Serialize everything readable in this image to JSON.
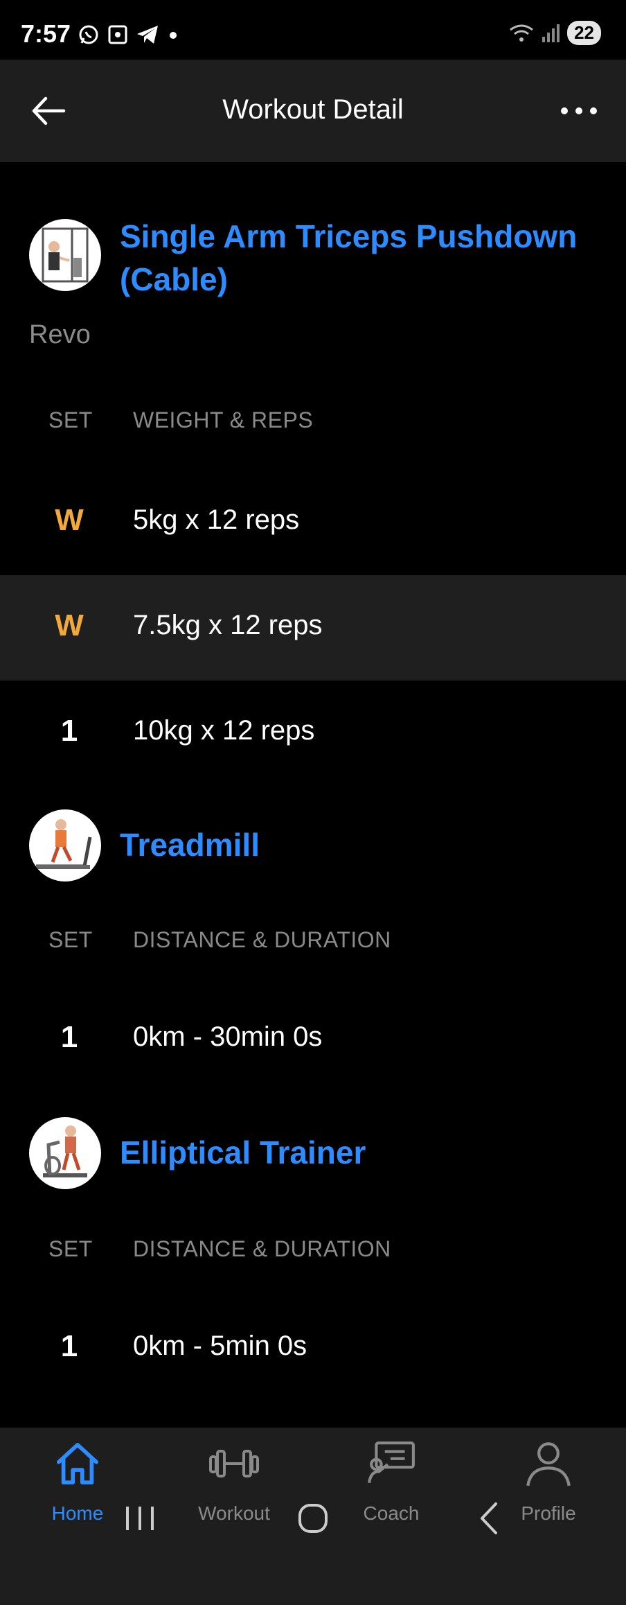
{
  "status_bar": {
    "time": "7:57",
    "battery": "22",
    "left_icons": [
      "whatsapp-icon",
      "screenshot-icon",
      "telegram-icon",
      "dot-icon"
    ],
    "right_icons": [
      "wifi-icon",
      "signal-icon",
      "battery-icon"
    ]
  },
  "app_bar": {
    "title": "Workout Detail",
    "back_icon": "arrow-left-icon",
    "more_icon": "more-horizontal-icon"
  },
  "exercises": [
    {
      "name": "Single Arm Triceps Pushdown (Cable)",
      "note": "Revo",
      "col_set": "SET",
      "col_value": "WEIGHT & REPS",
      "sets": [
        {
          "label": "W",
          "value": "5kg x 12 reps",
          "type": "warmup"
        },
        {
          "label": "W",
          "value": "7.5kg x 12 reps",
          "type": "warmup"
        },
        {
          "label": "1",
          "value": "10kg x 12 reps",
          "type": "normal"
        }
      ]
    },
    {
      "name": "Treadmill",
      "col_set": "SET",
      "col_value": "DISTANCE & DURATION",
      "sets": [
        {
          "label": "1",
          "value": "0km - 30min 0s",
          "type": "normal"
        }
      ]
    },
    {
      "name": "Elliptical Trainer",
      "col_set": "SET",
      "col_value": "DISTANCE & DURATION",
      "sets": [
        {
          "label": "1",
          "value": "0km - 5min 0s",
          "type": "normal"
        }
      ]
    }
  ],
  "bottom_nav": {
    "items": [
      {
        "label": "Home",
        "icon": "home-icon",
        "active": true
      },
      {
        "label": "Workout",
        "icon": "dumbbell-icon",
        "active": false
      },
      {
        "label": "Coach",
        "icon": "coach-icon",
        "active": false
      },
      {
        "label": "Profile",
        "icon": "person-icon",
        "active": false
      }
    ]
  },
  "system_nav": {
    "icons": [
      "recent-apps-icon",
      "home-circle-icon",
      "back-chevron-icon"
    ]
  },
  "colors": {
    "accent": "#2d8cff",
    "warmup": "#f2a93b",
    "background": "#000000",
    "surface": "#1e1e1e"
  }
}
